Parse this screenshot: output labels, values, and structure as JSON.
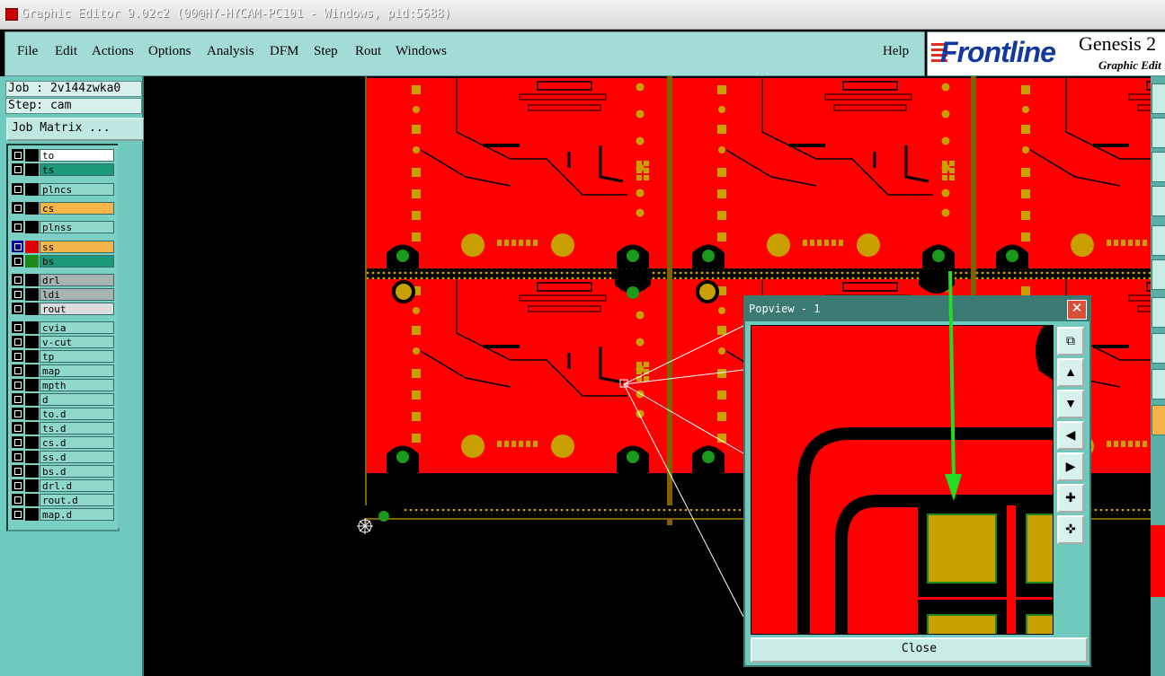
{
  "window": {
    "title": "Graphic Editor 9.02c2 (00@HY-HYCAM-PC101 - Windows, pid:5688)"
  },
  "menu": {
    "file": "File",
    "edit": "Edit",
    "actions": "Actions",
    "options": "Options",
    "analysis": "Analysis",
    "dfm": "DFM",
    "step": "Step",
    "rout": "Rout",
    "windows": "Windows",
    "help": "Help"
  },
  "brand": {
    "logo": "Frontline",
    "product": "Genesis 2",
    "subtitle": "Graphic Edit"
  },
  "job": {
    "job_label": "Job : 2v144zwka0",
    "step_label": "Step: cam",
    "matrix_button": "Job Matrix ..."
  },
  "layers": [
    {
      "name": "to",
      "color": "#ffffff"
    },
    {
      "name": "ts",
      "color": "#1a9a7a"
    },
    {
      "name": "plncs",
      "color": "#8fd8cc"
    },
    {
      "name": "cs",
      "color": "#f5b54a"
    },
    {
      "name": "plnss",
      "color": "#8fd8cc"
    },
    {
      "name": "ss",
      "color": "#f5b54a"
    },
    {
      "name": "bs",
      "color": "#1a9a7a"
    },
    {
      "name": "drl",
      "color": "#a8b4b4"
    },
    {
      "name": "ldi",
      "color": "#a8b4b4"
    },
    {
      "name": "rout",
      "color": "#dcdcdc"
    },
    {
      "name": "cvia",
      "color": "#8fd8cc"
    },
    {
      "name": "v-cut",
      "color": "#8fd8cc"
    },
    {
      "name": "tp",
      "color": "#8fd8cc"
    },
    {
      "name": "map",
      "color": "#8fd8cc"
    },
    {
      "name": "mpth",
      "color": "#8fd8cc"
    },
    {
      "name": "d",
      "color": "#8fd8cc"
    },
    {
      "name": "to.d",
      "color": "#8fd8cc"
    },
    {
      "name": "ts.d",
      "color": "#8fd8cc"
    },
    {
      "name": "cs.d",
      "color": "#8fd8cc"
    },
    {
      "name": "ss.d",
      "color": "#8fd8cc"
    },
    {
      "name": "bs.d",
      "color": "#8fd8cc"
    },
    {
      "name": "drl.d",
      "color": "#8fd8cc"
    },
    {
      "name": "rout.d",
      "color": "#8fd8cc"
    },
    {
      "name": "map.d",
      "color": "#8fd8cc"
    }
  ],
  "popview": {
    "title": "Popview - 1",
    "close_label": "Close"
  },
  "colors": {
    "copper": "#ff0000",
    "pad": "#c8a000",
    "drill": "#1a9a1a",
    "arrow": "#22dd22"
  }
}
